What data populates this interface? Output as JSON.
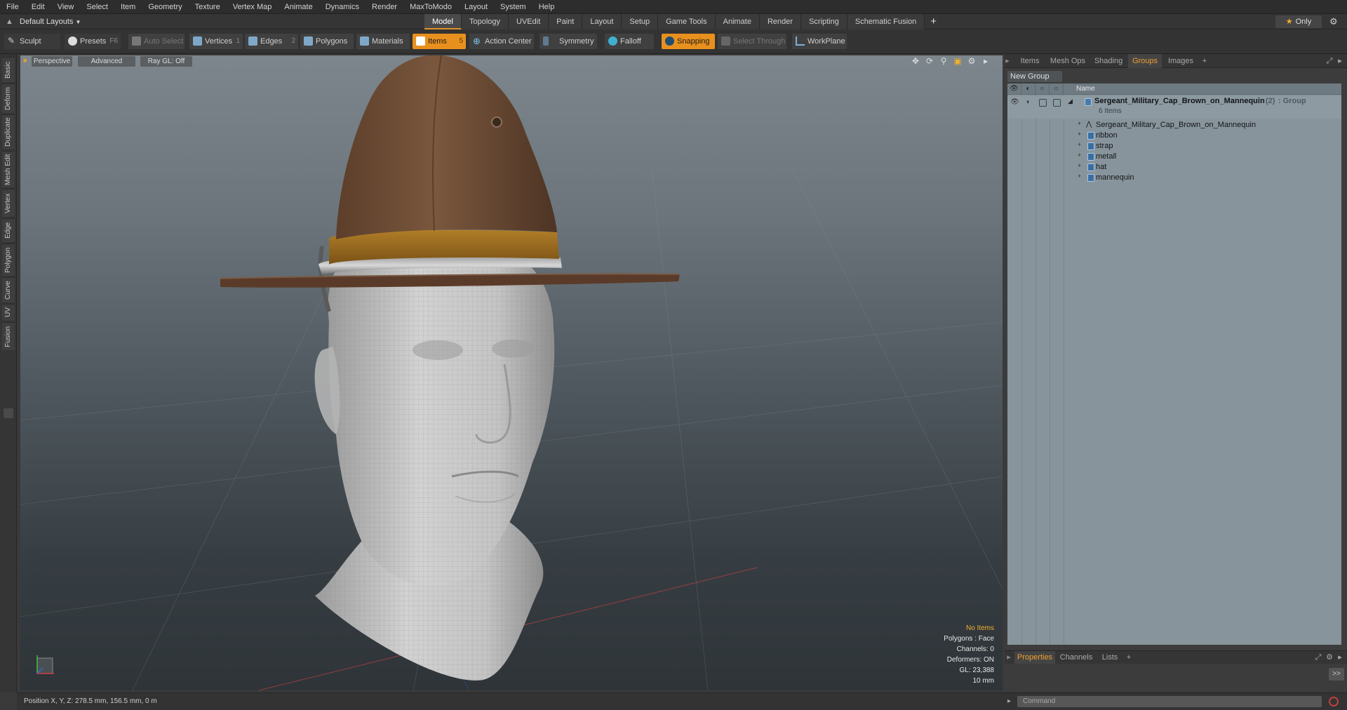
{
  "menu": [
    "File",
    "Edit",
    "View",
    "Select",
    "Item",
    "Geometry",
    "Texture",
    "Vertex Map",
    "Animate",
    "Dynamics",
    "Render",
    "MaxToModo",
    "Layout",
    "System",
    "Help"
  ],
  "layout": {
    "selector": "Default Layouts",
    "tabs": [
      "Model",
      "Topology",
      "UVEdit",
      "Paint",
      "Layout",
      "Setup",
      "Game Tools",
      "Animate",
      "Render",
      "Scripting",
      "Schematic Fusion"
    ],
    "active_tab": "Model",
    "only_label": "Only"
  },
  "toolbar": {
    "sculpt": "Sculpt",
    "presets": "Presets",
    "presets_key": "F6",
    "auto_select": "Auto Select",
    "vertices": "Vertices",
    "vertices_key": "1",
    "edges": "Edges",
    "edges_key": "2",
    "polygons": "Polygons",
    "materials": "Materials",
    "items": "Items",
    "items_key": "5",
    "action_center": "Action Center",
    "symmetry": "Symmetry",
    "falloff": "Falloff",
    "snapping": "Snapping",
    "select_through": "Select Through",
    "workplane": "WorkPlane"
  },
  "left_tabs": [
    "Basic",
    "Deform",
    "Duplicate",
    "Mesh Edit",
    "Vertex",
    "Edge",
    "Polygon",
    "Curve",
    "UV",
    "Fusion"
  ],
  "viewport": {
    "view_mode": "Perspective",
    "shading": "Advanced",
    "raygl": "Ray GL: Off",
    "info": {
      "selection": "No Items",
      "polygons": "Polygons : Face",
      "channels": "Channels: 0",
      "deformers": "Deformers: ON",
      "gl": "GL: 23,388",
      "scale": "10 mm"
    }
  },
  "right_panel": {
    "tabs": [
      "Items",
      "Mesh Ops",
      "Shading",
      "Groups",
      "Images"
    ],
    "active_tab": "Groups",
    "new_group": "New Group",
    "column_name": "Name",
    "group": {
      "name": "Sergeant_Military_Cap_Brown_on_Mannequin",
      "count": "(2)",
      "kind": ": Group",
      "items_label": "6 Items"
    },
    "items": [
      "Sergeant_Military_Cap_Brown_on_Mannequin",
      "ribbon",
      "strap",
      "metall",
      "hat",
      "mannequin"
    ]
  },
  "properties": {
    "tabs": [
      "Properties",
      "Channels",
      "Lists"
    ],
    "active_tab": "Properties",
    "expand": ">>"
  },
  "status": {
    "position": "Position X, Y, Z:  278.5 mm, 156.5 mm, 0 m"
  },
  "command": {
    "placeholder": "Command"
  },
  "colors": {
    "accent": "#e8901e",
    "viewport_top": "#7c868c",
    "viewport_bottom": "#2e3438",
    "hat_felt": "#6b4a33",
    "hat_band": "#9a6a1e",
    "mannequin": "#c8c8c8"
  }
}
